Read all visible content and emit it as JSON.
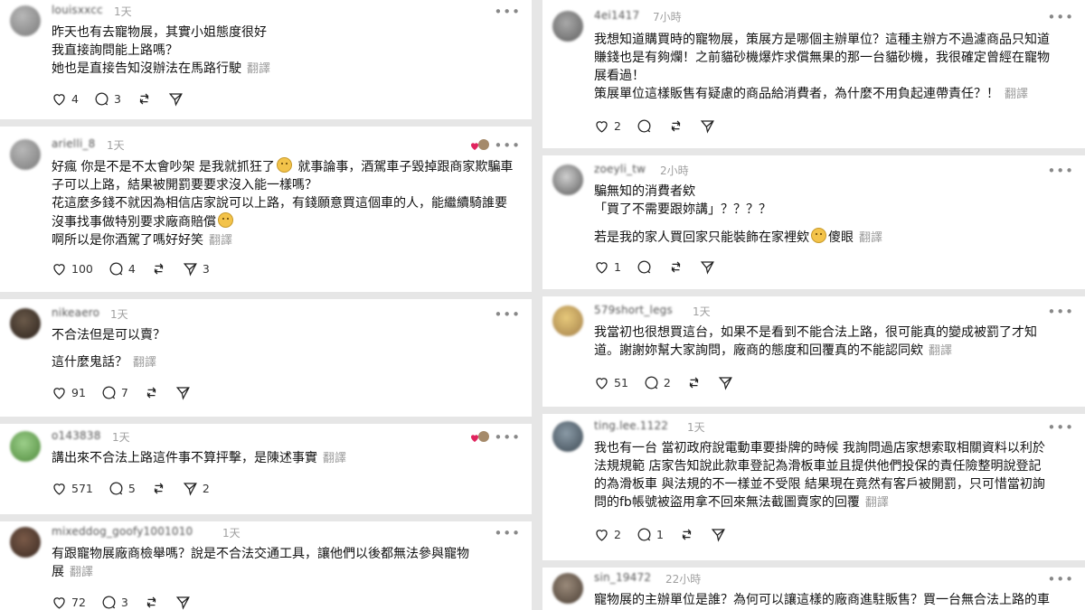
{
  "left_comments": [
    {
      "username": "louisxxcc",
      "time": "1天",
      "lines": [
        "昨天也有去寵物展，其實小姐態度很好",
        "我直接詢問能上路嗎？",
        "她也是直接告知沒辦法在馬路行駛"
      ],
      "translate": "翻譯",
      "likes": "4",
      "replies": "3",
      "shares": ""
    },
    {
      "username": "arielli_8",
      "time": "1天",
      "lines_a": "好瘋 你是不是不太會吵架 是我就抓狂了",
      "lines_a2": " 就事論事，酒駕車子毀掉跟商家欺騙車子可以上路，結果被開罰要要求沒入能一樣嗎？",
      "lines_b": "花這麼多錢不就因為相信店家說可以上路，有錢願意買這個車的人，能繼續騎誰要沒事找事做特別要求廠商賠償",
      "lines_c": "啊所以是你酒駕了嗎好好笑",
      "translate": "翻譯",
      "likes": "100",
      "replies": "4",
      "shares": "3"
    },
    {
      "username": "nikeaero",
      "time": "1天",
      "lines": [
        "不合法但是可以賣？"
      ],
      "line2": "這什麼鬼話？",
      "translate": "翻譯",
      "likes": "91",
      "replies": "7",
      "shares": ""
    },
    {
      "username": "o143838",
      "time": "1天",
      "lines": [
        "講出來不合法上路這件事不算抨擊，是陳述事實"
      ],
      "translate": "翻譯",
      "likes": "571",
      "replies": "5",
      "shares": "2"
    },
    {
      "username": "mixeddog_goofy1001010",
      "time": "1天",
      "lines": [
        "有跟寵物展廠商檢舉嗎？說是不合法交通工具，讓他們以後都無法參與寵物",
        "展"
      ],
      "translate": "翻譯",
      "likes": "72",
      "replies": "3",
      "shares": ""
    }
  ],
  "right_comments": [
    {
      "username": "4ei1417",
      "time": "7小時",
      "lines": [
        "我想知道購買時的寵物展，策展方是哪個主辦單位？這種主辦方不過濾商品只知道",
        "賺錢也是有夠爛！之前貓砂機爆炸求償無果的那一台貓砂機，我很確定曾經在寵物",
        "展看過！",
        "策展單位這樣販售有疑慮的商品給消費者，為什麼不用負起連帶責任？！"
      ],
      "translate": "翻譯",
      "likes": "2",
      "replies": "",
      "shares": ""
    },
    {
      "username": "zoeyli_tw",
      "time": "2小時",
      "lines": [
        "騙無知的消費者欸",
        "「買了不需要跟妳講」？？？？"
      ],
      "line2a": "若是我的家人買回家只能裝飾在家裡欸",
      "line2b": "傻眼",
      "translate": "翻譯",
      "likes": "1",
      "replies": "",
      "shares": ""
    },
    {
      "username": "579short_legs",
      "time": "1天",
      "lines": [
        "我當初也很想買這台，如果不是看到不能合法上路，很可能真的變成被罰了才知",
        "道。謝謝妳幫大家詢問，廠商的態度和回覆真的不能認同欸"
      ],
      "translate": "翻譯",
      "likes": "51",
      "replies": "2",
      "shares": ""
    },
    {
      "username": "ting.lee.1122",
      "time": "1天",
      "lines": [
        "我也有一台 當初政府說電動車要掛牌的時候 我詢問過店家想索取相關資料以利於",
        "法規規範 店家告知說此款車登記為滑板車並且提供他們投保的責任險整明說登記",
        "的為滑板車 與法規的不一樣並不受限 結果現在竟然有客戶被開罰，只可惜當初詢",
        "問的fb帳號被盜用拿不回來無法截圖賣家的回覆"
      ],
      "translate": "翻譯",
      "likes": "2",
      "replies": "1",
      "shares": ""
    },
    {
      "username": "sin_19472",
      "time": "22小時",
      "lines": [
        "寵物展的主辦單位是誰？為何可以讓這樣的廠商進駐販售？買一台無合法上路的車"
      ],
      "translate": "",
      "likes": "",
      "replies": "",
      "shares": ""
    }
  ],
  "more_label": "•••"
}
